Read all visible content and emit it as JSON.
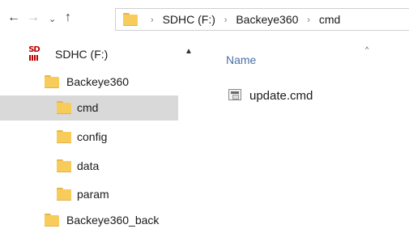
{
  "address": {
    "breadcrumbs": [
      "SDHC (F:)",
      "Backeye360",
      "cmd"
    ]
  },
  "nav": {
    "drive": "SDHC (F:)",
    "items": [
      "Backeye360",
      "cmd",
      "config",
      "data",
      "param",
      "Backeye360_back"
    ],
    "selected": "cmd"
  },
  "content": {
    "column_header": "Name",
    "files": [
      {
        "name": "update.cmd",
        "icon": "cmd-file-icon"
      }
    ]
  },
  "colors": {
    "folder": "#f7cc5a",
    "selection": "#d9d9d9",
    "header_text": "#4a6fa5"
  }
}
